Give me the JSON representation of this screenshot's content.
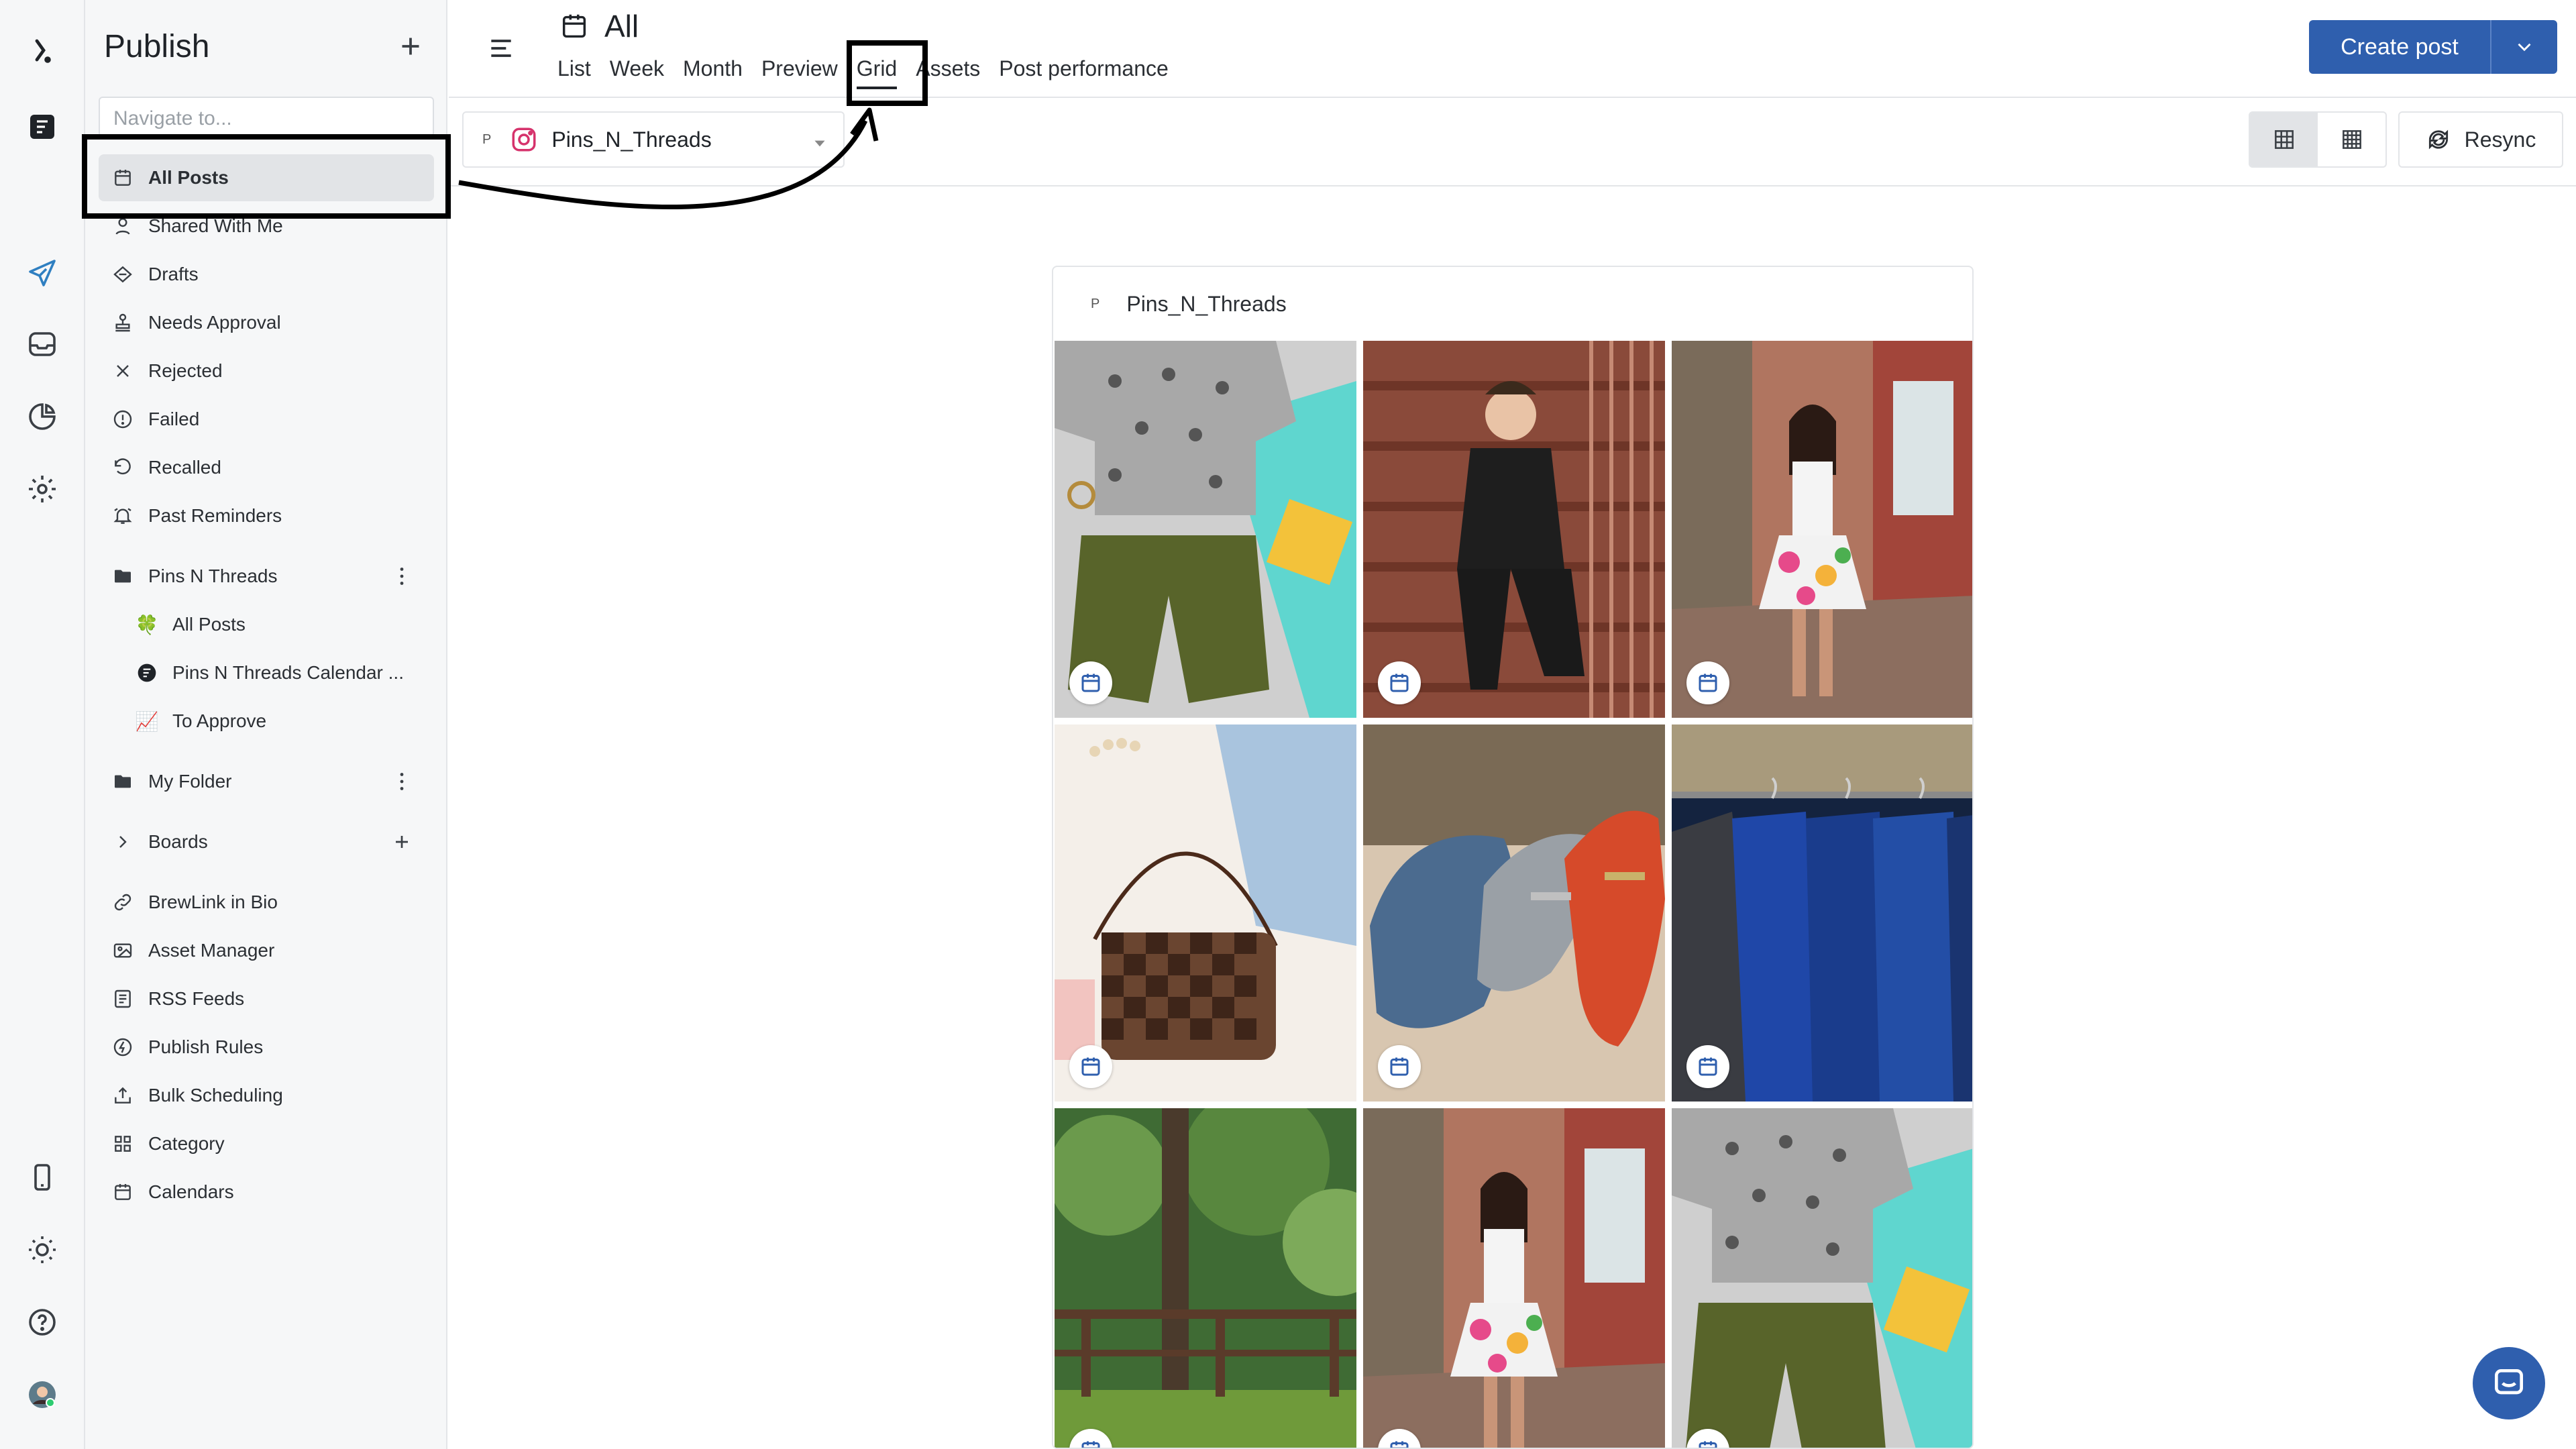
{
  "sidebar": {
    "title": "Publish",
    "navigate_placeholder": "Navigate to...",
    "items": [
      {
        "label": "All Posts"
      },
      {
        "label": "Shared With Me"
      },
      {
        "label": "Drafts"
      },
      {
        "label": "Needs Approval"
      },
      {
        "label": "Rejected"
      },
      {
        "label": "Failed"
      },
      {
        "label": "Recalled"
      },
      {
        "label": "Past Reminders"
      }
    ],
    "folders": [
      {
        "label": "Pins N Threads",
        "children": [
          {
            "label": "All Posts",
            "emoji": "🍀"
          },
          {
            "label": "Pins N Threads Calendar ...",
            "emoji": "⚫"
          },
          {
            "label": "To Approve",
            "emoji": "📈"
          }
        ]
      },
      {
        "label": "My Folder"
      }
    ],
    "boards_label": "Boards",
    "tools": [
      {
        "label": "BrewLink in Bio"
      },
      {
        "label": "Asset Manager"
      },
      {
        "label": "RSS Feeds"
      },
      {
        "label": "Publish Rules"
      },
      {
        "label": "Bulk Scheduling"
      },
      {
        "label": "Category"
      },
      {
        "label": "Calendars"
      }
    ]
  },
  "header": {
    "title": "All",
    "tabs": [
      "List",
      "Week",
      "Month",
      "Preview",
      "Grid",
      "Assets",
      "Post performance"
    ],
    "active_tab": "Grid",
    "create_label": "Create post"
  },
  "toolbar": {
    "account_prefix": "P",
    "account_name": "Pins_N_Threads",
    "resync_label": "Resync"
  },
  "feed": {
    "account_prefix": "P",
    "account_name": "Pins_N_Threads",
    "tiles": [
      {
        "subject": "tshirt-and-shorts-flatlay"
      },
      {
        "subject": "man-on-stairs"
      },
      {
        "subject": "woman-floral-skirt"
      },
      {
        "subject": "checkered-bag"
      },
      {
        "subject": "loafers"
      },
      {
        "subject": "blue-suits-rack"
      },
      {
        "subject": "forest-fence"
      },
      {
        "subject": "woman-floral-skirt"
      },
      {
        "subject": "tshirt-and-shorts-flatlay"
      }
    ]
  },
  "colors": {
    "accent": "#2f5fae",
    "instagram": "#d6336c"
  }
}
